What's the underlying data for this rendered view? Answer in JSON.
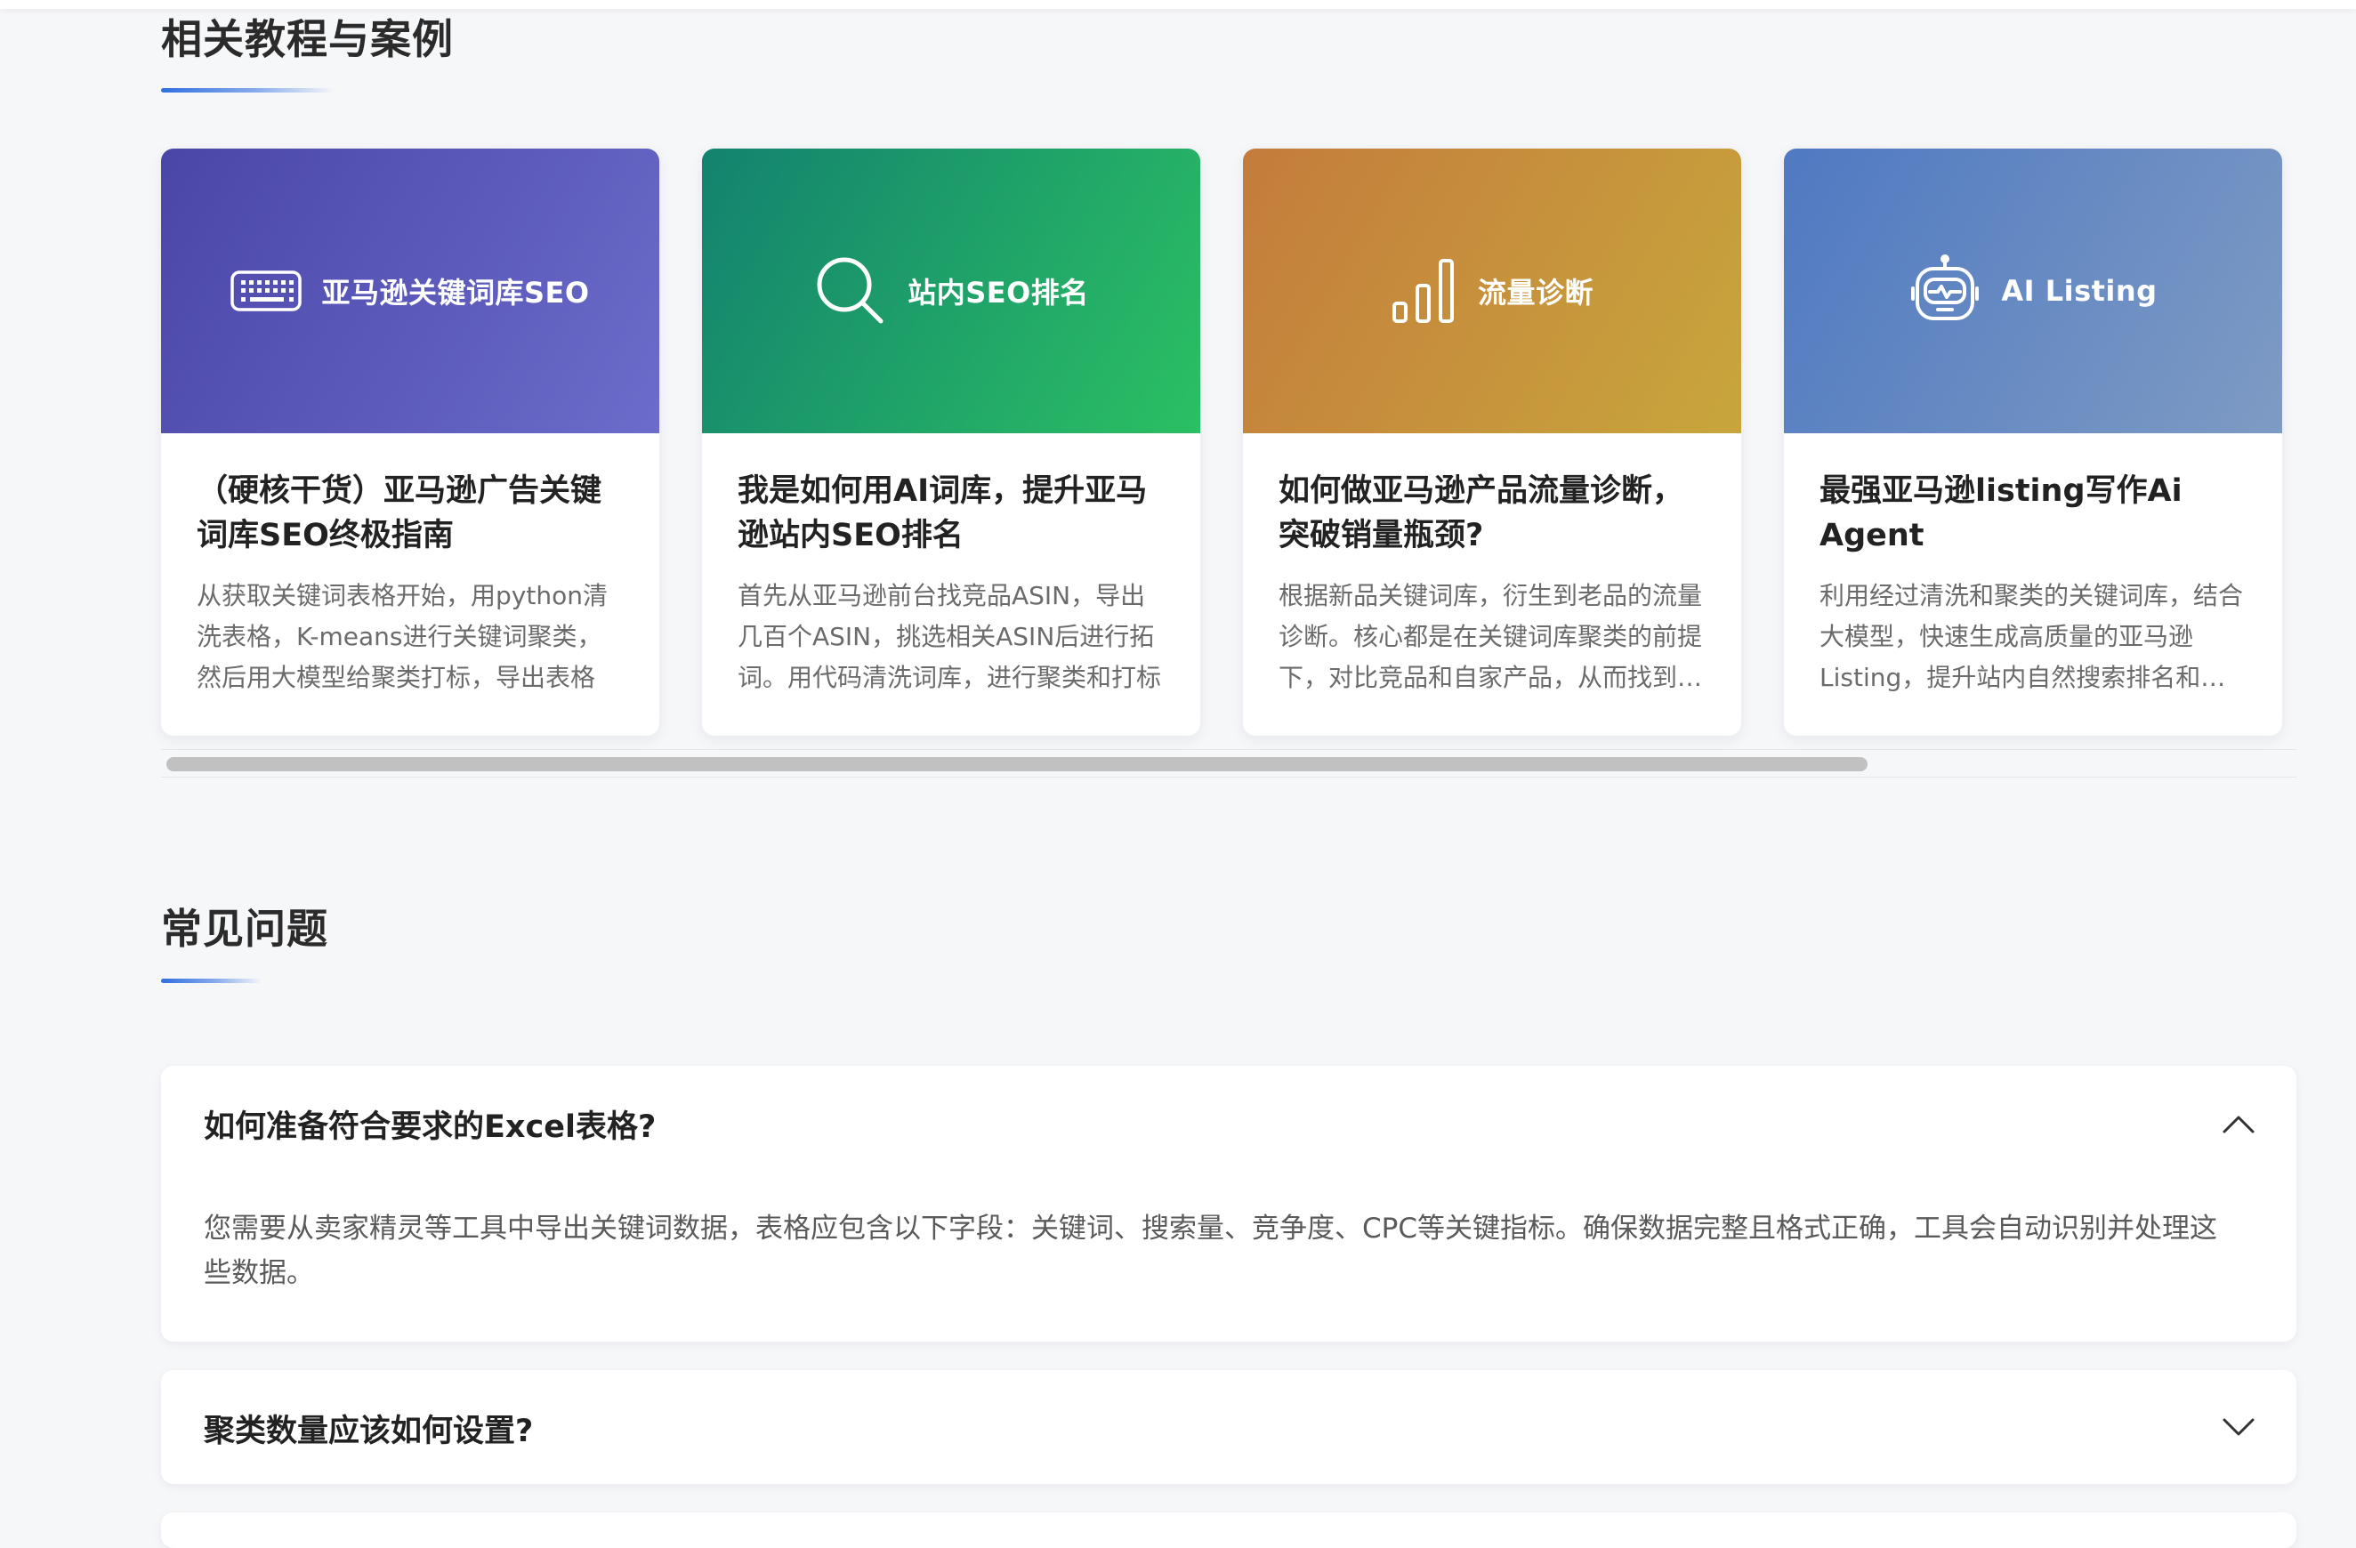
{
  "tutorials": {
    "title": "相关教程与案例",
    "cards": [
      {
        "banner_label": "亚马逊关键词库SEO",
        "icon": "keyboard-icon",
        "title": "（硬核干货）亚马逊广告关键词库SEO终极指南",
        "desc": "从获取关键词表格开始，用python清洗表格，K-means进行关键词聚类，然后用大模型给聚类打标，导出表格"
      },
      {
        "banner_label": "站内SEO排名",
        "icon": "search-icon",
        "title": "我是如何用AI词库，提升亚马逊站内SEO排名",
        "desc": "首先从亚马逊前台找竞品ASIN，导出几百个ASIN，挑选相关ASIN后进行拓词。用代码清洗词库，进行聚类和打标"
      },
      {
        "banner_label": "流量诊断",
        "icon": "bar-chart-icon",
        "title": "如何做亚马逊产品流量诊断，突破销量瓶颈?",
        "desc": "根据新品关键词库，衍生到老品的流量诊断。核心都是在关键词库聚类的前提下，对比竞品和自家产品，从而找到问题"
      },
      {
        "banner_label": "AI Listing",
        "icon": "robot-icon",
        "title": "最强亚马逊listing写作Ai Agent",
        "desc": "利用经过清洗和聚类的关键词库，结合大模型，快速生成高质量的亚马逊Listing，提升站内自然搜索排名和转化率"
      }
    ]
  },
  "faq": {
    "title": "常见问题",
    "items": [
      {
        "question": "如何准备符合要求的Excel表格?",
        "answer": "您需要从卖家精灵等工具中导出关键词数据，表格应包含以下字段：关键词、搜索量、竞争度、CPC等关键指标。确保数据完整且格式正确，工具会自动识别并处理这些数据。",
        "expanded": true
      },
      {
        "question": "聚类数量应该如何设置?",
        "expanded": false
      }
    ]
  },
  "colors": {
    "accent": "#2f6fe0",
    "page_bg": "#f6f7f9"
  }
}
